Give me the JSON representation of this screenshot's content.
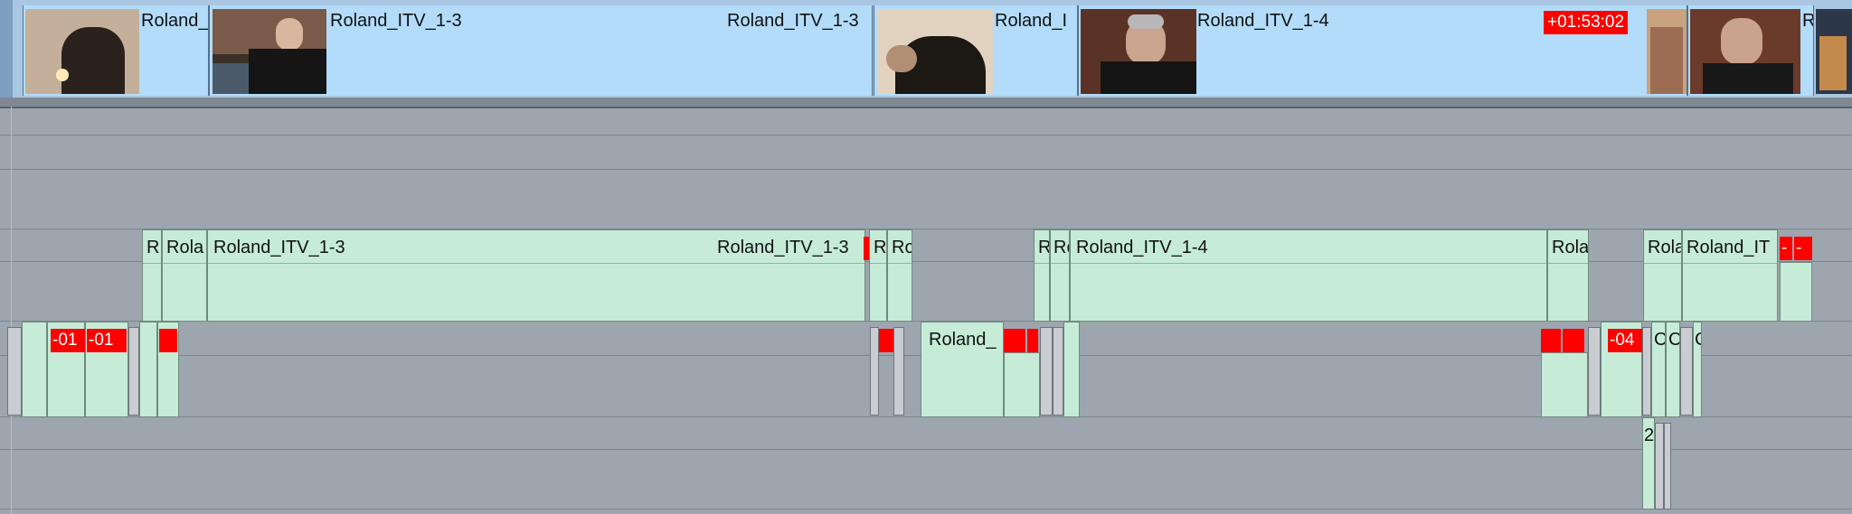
{
  "video_track": {
    "clips": [
      {
        "name": "Roland_",
        "tail_name": ""
      },
      {
        "name": "Roland_ITV_1-3",
        "tail_name": "Roland_ITV_1-3"
      },
      {
        "name": "Roland_I",
        "tail_name": ""
      },
      {
        "name": "Roland_ITV_1-4",
        "tail_name": ""
      },
      {
        "name": "R",
        "tail_name": ""
      }
    ],
    "timecode": "+01:53:02"
  },
  "audio_track_1": {
    "clips": [
      {
        "name": "R"
      },
      {
        "name": "Rola"
      },
      {
        "name": "Roland_ITV_1-3",
        "tail_name": "Roland_ITV_1-3"
      },
      {
        "name": "R"
      },
      {
        "name": "Ro"
      },
      {
        "name": "R"
      },
      {
        "name": "Ro"
      },
      {
        "name": "Roland_ITV_1-4"
      },
      {
        "name": "Rola"
      },
      {
        "name": "Rola"
      },
      {
        "name": "Roland_IT"
      }
    ]
  },
  "audio_track_2": {
    "clips": [
      {
        "name": "Roland_"
      }
    ],
    "red_labels": [
      "-01",
      "-01",
      "-04"
    ],
    "slug_chars": [
      "C",
      "C",
      "C"
    ]
  },
  "audio_track_3": {
    "label": "2"
  },
  "colors": {
    "video_clip": "#b3dcfa",
    "audio_clip": "#c6ecd8",
    "timecode_badge": "#ff0000",
    "track_bg": "#9da5ae"
  }
}
